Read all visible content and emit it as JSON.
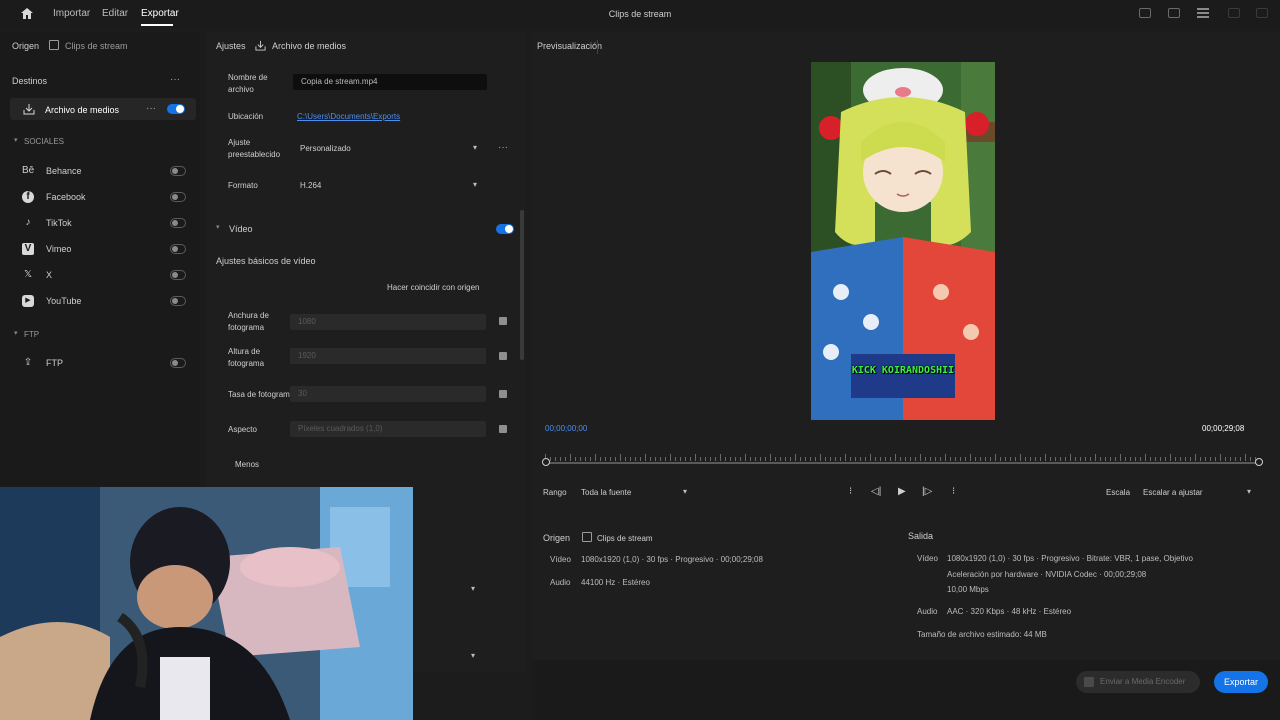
{
  "topbar": {
    "tabs": [
      "Importar",
      "Editar",
      "Exportar"
    ],
    "active_tab": "Exportar",
    "title": "Clips de stream"
  },
  "left": {
    "source_label": "Origen",
    "source_value": "Clips de stream",
    "section_title": "Destinos",
    "media_file_label": "Archivo de medios",
    "group_social": "SOCIALES",
    "destinations": [
      {
        "name": "Behance",
        "icon": "behance-icon"
      },
      {
        "name": "Facebook",
        "icon": "facebook-icon"
      },
      {
        "name": "TikTok",
        "icon": "tiktok-icon"
      },
      {
        "name": "Vimeo",
        "icon": "vimeo-icon"
      },
      {
        "name": "X",
        "icon": "x-icon"
      },
      {
        "name": "YouTube",
        "icon": "youtube-icon"
      }
    ],
    "group_ftp": "FTP",
    "ftp_item": "FTP"
  },
  "mid": {
    "settings_label": "Ajustes",
    "media_file_label": "Archivo de medios",
    "file_name_label": "Nombre de archivo",
    "file_name_value": "Copia de stream.mp4",
    "location_label": "Ubicación",
    "location_value": "C:\\Users\\Documents\\Exports",
    "preset_label": "Ajuste preestablecido",
    "preset_value": "Personalizado",
    "format_label": "Formato",
    "format_value": "H.264",
    "video_section": "Vídeo",
    "basic_video_label": "Ajustes básicos de vídeo",
    "match_source_label": "Hacer coincidir con origen",
    "frame_width_label": "Anchura de fotograma",
    "frame_width_value": "1080",
    "frame_height_label": "Altura de fotograma",
    "frame_height_value": "1920",
    "frame_rate_label": "Tasa de fotogramas",
    "frame_rate_value": "30",
    "aspect_label": "Aspecto",
    "aspect_value": "Píxeles cuadrados (1,0)",
    "more_label": "Menos"
  },
  "right": {
    "preview_title": "Previsualización",
    "timecode_in": "00;00;00;00",
    "timecode_out": "00;00;29;08",
    "range_label": "Rango",
    "range_value": "Toda la fuente",
    "scale_label": "Escala",
    "scale_value": "Escalar a ajustar",
    "overlay_text": "KICK KOIRANDOSHII",
    "source_label": "Origen",
    "source_name": "Clips de stream",
    "source_video_label": "Vídeo",
    "source_video_value": "1080x1920 (1,0)  ·  30 fps  ·  Progresivo  ·  00;00;29;08",
    "source_audio_label": "Audio",
    "source_audio_value": "44100 Hz  ·  Estéreo",
    "output_label": "Salida",
    "output_video_label": "Vídeo",
    "output_video_value": "1080x1920 (1,0)  ·  30 fps  ·  Progresivo  ·  Bitrate: VBR, 1 pase, Objetivo",
    "output_video_value2": "Aceleración por hardware  ·  NVIDIA Codec  ·  00;00;29;08",
    "output_video_value3": "10,00 Mbps",
    "output_audio_label": "Audio",
    "output_audio_value": "AAC  ·  320 Kbps  ·  48 kHz  ·  Estéreo",
    "size_label": "Tamaño de archivo estimado: 44 MB"
  },
  "footer": {
    "queue_label": "Enviar a Media Encoder",
    "export_label": "Exportar"
  },
  "colors": {
    "accent": "#1473e6",
    "background": "#1c1c1c"
  }
}
